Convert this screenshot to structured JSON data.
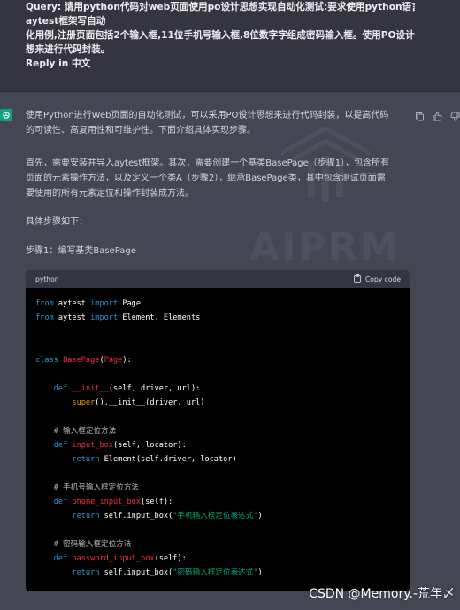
{
  "query": {
    "lines": [
      "Query: 请用python代码对web页面使用po设计思想实现自动化测试:要求使用python语言的",
      "aytest框架写自动",
      "化用例,注册页面包括2个输入框,11位手机号输入框,8位数字字组成密码输入框。使用PO设计思",
      "想来进行代码封装。",
      "Reply in 中文"
    ]
  },
  "answer": {
    "paragraphs": [
      [
        "使用Python进行Web页面的自动化测试，可以采用PO设计思想来进行代码封装，以提高代码",
        "的可读性、高复用性和可维护性。下面介绍具体实现步骤。"
      ],
      [
        "首先，需要安装并导入aytest框架。其次，需要创建一个基类BasePage（步骤1），包含所有",
        "页面的元素操作方法，以及定义一个类A（步骤2），继承BasePage类，其中包含测试页面需",
        "要使用的所有元素定位和操作封装成方法。"
      ],
      [
        "具体步骤如下："
      ],
      [
        "步骤1：编写基类BasePage"
      ]
    ]
  },
  "code_block": {
    "language": "python",
    "copy_label": "Copy code",
    "lines": [
      [
        [
          "kw",
          "from"
        ],
        [
          "tx",
          " aytest "
        ],
        [
          "kw",
          "import"
        ],
        [
          "tx",
          " Page"
        ]
      ],
      [
        [
          "kw",
          "from"
        ],
        [
          "tx",
          " aytest "
        ],
        [
          "kw",
          "import"
        ],
        [
          "tx",
          " Element, Elements"
        ]
      ],
      [],
      [],
      [
        [
          "kw",
          "class"
        ],
        [
          "tx",
          " "
        ],
        [
          "fn",
          "BasePage"
        ],
        [
          "tx",
          "("
        ],
        [
          "fn",
          "Page"
        ],
        [
          "tx",
          "):"
        ]
      ],
      [],
      [
        [
          "tx",
          "    "
        ],
        [
          "kw",
          "def"
        ],
        [
          "tx",
          " "
        ],
        [
          "fn",
          "__init__"
        ],
        [
          "tx",
          "(self, driver, url):"
        ]
      ],
      [
        [
          "tx",
          "        "
        ],
        [
          "bi",
          "super"
        ],
        [
          "tx",
          "().__init__(driver, url)"
        ]
      ],
      [],
      [
        [
          "cm",
          "    # 输入框定位方法"
        ]
      ],
      [
        [
          "tx",
          "    "
        ],
        [
          "kw",
          "def"
        ],
        [
          "tx",
          " "
        ],
        [
          "fn",
          "input_box"
        ],
        [
          "tx",
          "(self, locator):"
        ]
      ],
      [
        [
          "tx",
          "        "
        ],
        [
          "kw",
          "return"
        ],
        [
          "tx",
          " Element(self.driver, locator)"
        ]
      ],
      [],
      [
        [
          "cm",
          "    # 手机号输入框定位方法"
        ]
      ],
      [
        [
          "tx",
          "    "
        ],
        [
          "kw",
          "def"
        ],
        [
          "tx",
          " "
        ],
        [
          "fn",
          "phone_input_box"
        ],
        [
          "tx",
          "(self):"
        ]
      ],
      [
        [
          "tx",
          "        "
        ],
        [
          "kw",
          "return"
        ],
        [
          "tx",
          " self.input_box("
        ],
        [
          "st",
          "\"手机输入框定位表达式\""
        ],
        [
          "tx",
          ")"
        ]
      ],
      [],
      [
        [
          "cm",
          "    # 密码输入框定位方法"
        ]
      ],
      [
        [
          "tx",
          "    "
        ],
        [
          "kw",
          "def"
        ],
        [
          "tx",
          " "
        ],
        [
          "fn",
          "password_input_box"
        ],
        [
          "tx",
          "(self):"
        ]
      ],
      [
        [
          "tx",
          "        "
        ],
        [
          "kw",
          "return"
        ],
        [
          "tx",
          " self.input_box("
        ],
        [
          "st",
          "\"密码输入框定位表达式\""
        ],
        [
          "tx",
          ")"
        ]
      ]
    ]
  },
  "watermark": {
    "text": "AIPRM",
    "credit": "CSDN @Memory.-荒年〆"
  },
  "icons": {
    "avatar": "openai-logo-icon",
    "actions": [
      "copy-icon",
      "thumbs-up-icon",
      "thumbs-down-icon"
    ],
    "copy": "clipboard-icon"
  },
  "colors": {
    "background": "#343541",
    "answer_background": "#444654",
    "avatar": "#10a37f",
    "code_background": "#000000",
    "keyword": "#2e95d3",
    "function": "#f22c3d",
    "builtin": "#e9950c",
    "string": "#00a67d"
  }
}
